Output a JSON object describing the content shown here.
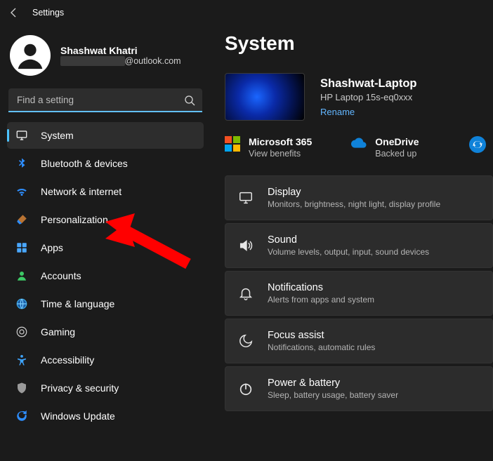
{
  "titlebar": {
    "title": "Settings"
  },
  "profile": {
    "name": "Shashwat Khatri",
    "email_suffix": "@outlook.com"
  },
  "search": {
    "placeholder": "Find a setting"
  },
  "nav": {
    "items": [
      {
        "id": "system",
        "label": "System",
        "icon": "display",
        "active": true
      },
      {
        "id": "bluetooth",
        "label": "Bluetooth & devices",
        "icon": "bluetooth"
      },
      {
        "id": "network",
        "label": "Network & internet",
        "icon": "wifi"
      },
      {
        "id": "personalization",
        "label": "Personalization",
        "icon": "brush"
      },
      {
        "id": "apps",
        "label": "Apps",
        "icon": "apps"
      },
      {
        "id": "accounts",
        "label": "Accounts",
        "icon": "person"
      },
      {
        "id": "time",
        "label": "Time & language",
        "icon": "globe"
      },
      {
        "id": "gaming",
        "label": "Gaming",
        "icon": "gaming"
      },
      {
        "id": "accessibility",
        "label": "Accessibility",
        "icon": "accessibility"
      },
      {
        "id": "privacy",
        "label": "Privacy & security",
        "icon": "shield"
      },
      {
        "id": "update",
        "label": "Windows Update",
        "icon": "update"
      }
    ]
  },
  "page": {
    "title": "System"
  },
  "device": {
    "name": "Shashwat-Laptop",
    "model": "HP Laptop 15s-eq0xxx",
    "rename": "Rename"
  },
  "services": {
    "ms365": {
      "title": "Microsoft 365",
      "sub": "View benefits"
    },
    "onedrive": {
      "title": "OneDrive",
      "sub": "Backed up"
    }
  },
  "cards": [
    {
      "id": "display",
      "title": "Display",
      "sub": "Monitors, brightness, night light, display profile",
      "icon": "display"
    },
    {
      "id": "sound",
      "title": "Sound",
      "sub": "Volume levels, output, input, sound devices",
      "icon": "sound"
    },
    {
      "id": "notifications",
      "title": "Notifications",
      "sub": "Alerts from apps and system",
      "icon": "bell"
    },
    {
      "id": "focus",
      "title": "Focus assist",
      "sub": "Notifications, automatic rules",
      "icon": "moon"
    },
    {
      "id": "power",
      "title": "Power & battery",
      "sub": "Sleep, battery usage, battery saver",
      "icon": "power"
    }
  ]
}
